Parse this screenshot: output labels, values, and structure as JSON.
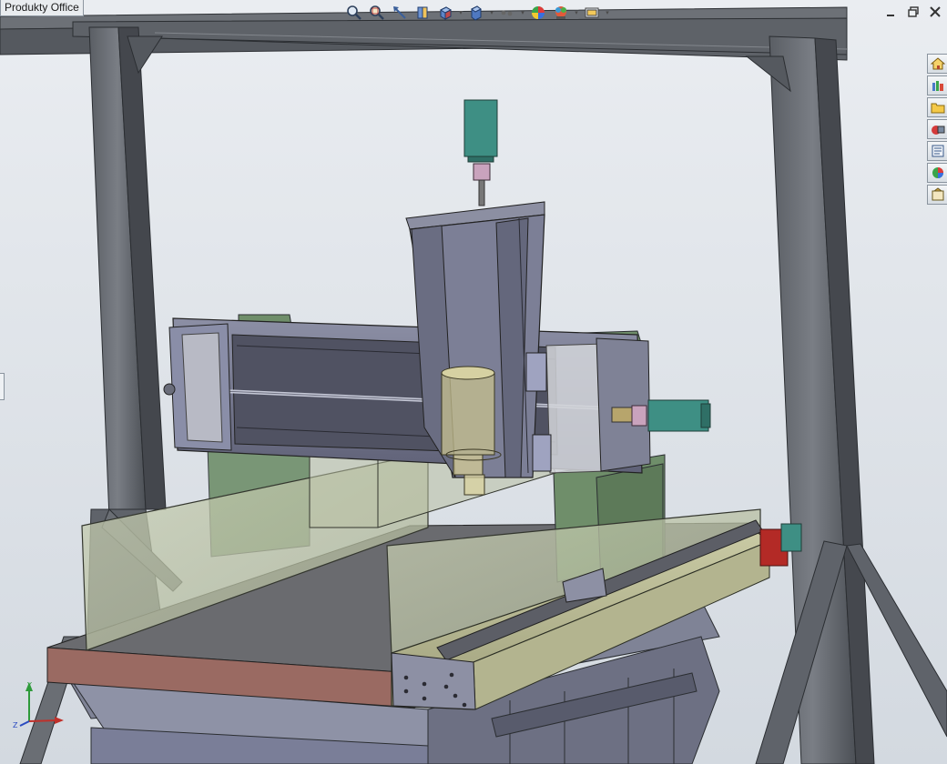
{
  "office_tab": {
    "label": "Produkty Office"
  },
  "hud_toolbar": {
    "buttons": [
      {
        "name": "zoom-to-fit",
        "icon": "zoom-fit-icon"
      },
      {
        "name": "zoom-to-area",
        "icon": "zoom-area-icon"
      },
      {
        "name": "previous-view",
        "icon": "previous-view-icon"
      },
      {
        "name": "section-view",
        "icon": "section-view-icon"
      },
      {
        "name": "view-orientation",
        "icon": "view-orientation-icon"
      },
      {
        "name": "display-style",
        "icon": "display-style-icon"
      },
      {
        "name": "hide-show-items",
        "icon": "hide-show-icon"
      },
      {
        "name": "edit-appearance",
        "icon": "appearance-icon"
      },
      {
        "name": "apply-scene",
        "icon": "scene-icon"
      },
      {
        "name": "view-settings",
        "icon": "view-settings-icon"
      }
    ]
  },
  "window_controls": [
    "minimize-icon",
    "restore-icon",
    "close-icon"
  ],
  "task_pane": [
    {
      "name": "resources",
      "icon": "home-icon"
    },
    {
      "name": "design-library",
      "icon": "library-icon"
    },
    {
      "name": "file-explorer",
      "icon": "folder-icon"
    },
    {
      "name": "view-palette",
      "icon": "view-palette-icon"
    },
    {
      "name": "properties",
      "icon": "properties-icon"
    },
    {
      "name": "appearances",
      "icon": "appearances-icon"
    },
    {
      "name": "custom-properties",
      "icon": "custom-properties-icon"
    }
  ],
  "colors": {
    "background": "#dde2e8",
    "steel": "#6b6f76",
    "steel_dark": "#3f4248",
    "gantry": "#7c7f96",
    "green_parts": "#6f8e6a",
    "motor_teal": "#3e8f84",
    "table_red": "#9a6a62",
    "glass": "#c7cfb0"
  }
}
